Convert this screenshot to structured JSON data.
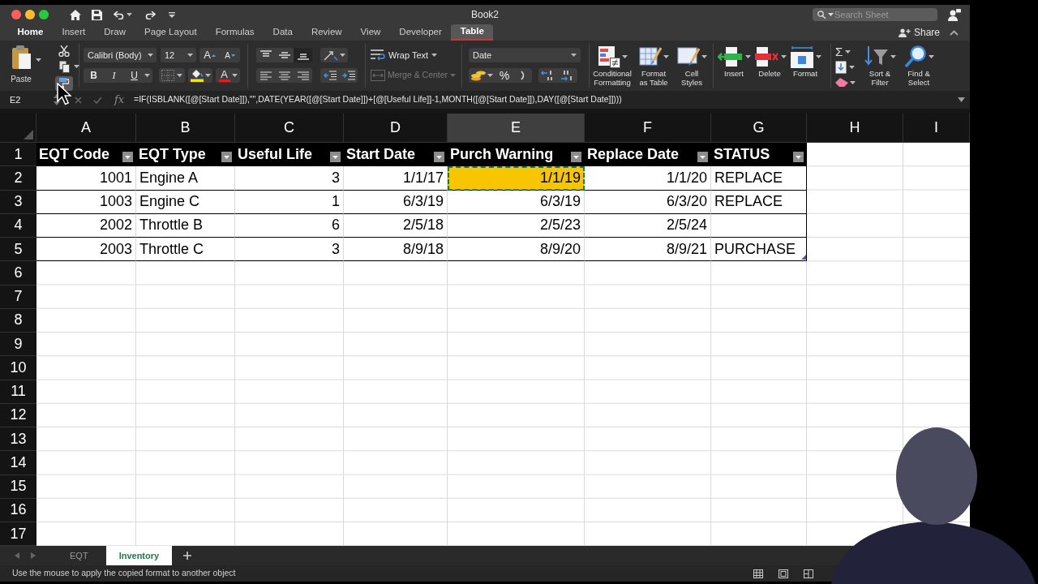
{
  "window": {
    "title": "Book2"
  },
  "search": {
    "placeholder": "Search Sheet"
  },
  "tabs": [
    {
      "label": "Home",
      "selected": true,
      "kind": "standard"
    },
    {
      "label": "Insert",
      "selected": false,
      "kind": "standard"
    },
    {
      "label": "Draw",
      "selected": false,
      "kind": "standard"
    },
    {
      "label": "Page Layout",
      "selected": false,
      "kind": "standard"
    },
    {
      "label": "Formulas",
      "selected": false,
      "kind": "standard"
    },
    {
      "label": "Data",
      "selected": false,
      "kind": "standard"
    },
    {
      "label": "Review",
      "selected": false,
      "kind": "standard"
    },
    {
      "label": "View",
      "selected": false,
      "kind": "standard"
    },
    {
      "label": "Developer",
      "selected": false,
      "kind": "standard"
    },
    {
      "label": "Table",
      "selected": false,
      "kind": "contextual"
    }
  ],
  "share": {
    "label": "Share"
  },
  "ribbon": {
    "clipboard": {
      "paste_label": "Paste",
      "format_painter_on": true
    },
    "font": {
      "name": "Calibri (Body)",
      "size": "12",
      "grow_label": "A",
      "shrink_label": "A",
      "style_buttons": [
        {
          "label": "B",
          "kind": "bold"
        },
        {
          "label": "I",
          "kind": "italic"
        },
        {
          "label": "U",
          "kind": "underline"
        }
      ],
      "font_color_label": "A"
    },
    "vertical_align": [
      {
        "kind": "top",
        "selected": false
      },
      {
        "kind": "middle",
        "selected": false
      },
      {
        "kind": "bottom",
        "selected": true
      }
    ],
    "wrap_text": {
      "label": "Wrap Text"
    },
    "merge_center": {
      "label": "Merge & Center",
      "disabled": true
    },
    "number_format": {
      "value": "Date"
    },
    "percent_label": "%",
    "styles_buttons": [
      {
        "label": "Conditional\nFormatting",
        "kind": "conditional"
      },
      {
        "label": "Format\nas Table",
        "kind": "table"
      },
      {
        "label": "Cell\nStyles",
        "kind": "styles"
      }
    ],
    "cells_buttons": [
      {
        "label": "Insert",
        "kind": "insert"
      },
      {
        "label": "Delete",
        "kind": "delete"
      },
      {
        "label": "Format",
        "kind": "format"
      }
    ],
    "autosum_label": "Σ",
    "editing_buttons": [
      {
        "label": "Sort &\nFilter",
        "kind": "sort"
      },
      {
        "label": "Find &\nSelect",
        "kind": "find"
      }
    ]
  },
  "formula_bar": {
    "name_box": "E2",
    "function_label": "fx",
    "formula": "=IF(ISBLANK([@[Start Date]]),\"\",DATE(YEAR([@[Start Date]])+[@[Useful Life]]-1,MONTH([@[Start Date]]),DAY([@[Start Date]])))"
  },
  "column_headers": [
    {
      "label": "A",
      "selected": false
    },
    {
      "label": "B",
      "selected": false
    },
    {
      "label": "C",
      "selected": false
    },
    {
      "label": "D",
      "selected": false
    },
    {
      "label": "E",
      "selected": true
    },
    {
      "label": "F",
      "selected": false
    },
    {
      "label": "G",
      "selected": false
    },
    {
      "label": "H",
      "selected": false
    },
    {
      "label": "I",
      "selected": false
    }
  ],
  "row_headers": [
    "1",
    "2",
    "3",
    "4",
    "5",
    "6",
    "7",
    "8",
    "9",
    "10",
    "11",
    "12",
    "13",
    "14",
    "15",
    "16",
    "17"
  ],
  "table": {
    "columns": [
      {
        "label": "EQT Code",
        "kind": "number"
      },
      {
        "label": "EQT Type",
        "kind": "text"
      },
      {
        "label": "Useful Life",
        "kind": "number"
      },
      {
        "label": "Start Date",
        "kind": "number"
      },
      {
        "label": "Purch Warning",
        "kind": "number"
      },
      {
        "label": "Replace Date",
        "kind": "number"
      },
      {
        "label": "STATUS",
        "kind": "text"
      }
    ],
    "rows": [
      {
        "cells": [
          {
            "text": "1001",
            "selected": false
          },
          {
            "text": "Engine A",
            "selected": false
          },
          {
            "text": "3",
            "selected": false
          },
          {
            "text": "1/1/17",
            "selected": false
          },
          {
            "text": "1/1/19",
            "selected": true
          },
          {
            "text": "1/1/20",
            "selected": false
          },
          {
            "text": "REPLACE",
            "selected": false
          }
        ]
      },
      {
        "cells": [
          {
            "text": "1003",
            "selected": false
          },
          {
            "text": "Engine C",
            "selected": false
          },
          {
            "text": "1",
            "selected": false
          },
          {
            "text": "6/3/19",
            "selected": false
          },
          {
            "text": "6/3/19",
            "selected": false
          },
          {
            "text": "6/3/20",
            "selected": false
          },
          {
            "text": "REPLACE",
            "selected": false
          }
        ]
      },
      {
        "cells": [
          {
            "text": "2002",
            "selected": false
          },
          {
            "text": "Throttle B",
            "selected": false
          },
          {
            "text": "6",
            "selected": false
          },
          {
            "text": "2/5/18",
            "selected": false
          },
          {
            "text": "2/5/23",
            "selected": false
          },
          {
            "text": "2/5/24",
            "selected": false
          },
          {
            "selected": false
          }
        ]
      },
      {
        "cells": [
          {
            "text": "2003",
            "selected": false
          },
          {
            "text": "Throttle C",
            "selected": false
          },
          {
            "text": "3",
            "selected": false
          },
          {
            "text": "8/9/18",
            "selected": false
          },
          {
            "text": "8/9/20",
            "selected": false
          },
          {
            "text": "8/9/21",
            "selected": false
          },
          {
            "text": "PURCHASE",
            "selected": false
          }
        ]
      }
    ]
  },
  "sheet_tabs": [
    {
      "label": "EQT",
      "selected": false
    },
    {
      "label": "Inventory",
      "selected": true
    }
  ],
  "status_bar": {
    "message": "Use the mouse to apply the copied format to another object"
  }
}
